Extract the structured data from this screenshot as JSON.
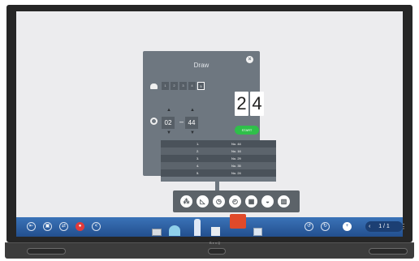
{
  "draw_panel": {
    "title": "Draw",
    "participant_options": [
      "1",
      "2",
      "3",
      "4",
      "5"
    ],
    "selected_option": "5",
    "timer_minutes": "02",
    "timer_separator": "–",
    "timer_seconds": "44",
    "display_digits": [
      "2",
      "4"
    ],
    "start_label": "START",
    "results": [
      {
        "index": "1.",
        "value": "No. 44"
      },
      {
        "index": "2.",
        "value": "No. 16"
      },
      {
        "index": "3.",
        "value": "No. 29"
      },
      {
        "index": "4.",
        "value": "No. 35"
      },
      {
        "index": "5.",
        "value": "No. 24"
      }
    ]
  },
  "taskbar": {
    "page_indicator": "1 / 1",
    "accent_color": "#2c5a9a"
  },
  "stand": {
    "brand": "BenQ"
  },
  "colors": {
    "panel": "#6e7780",
    "start": "#2fbf4a",
    "record": "#e23b3b"
  }
}
